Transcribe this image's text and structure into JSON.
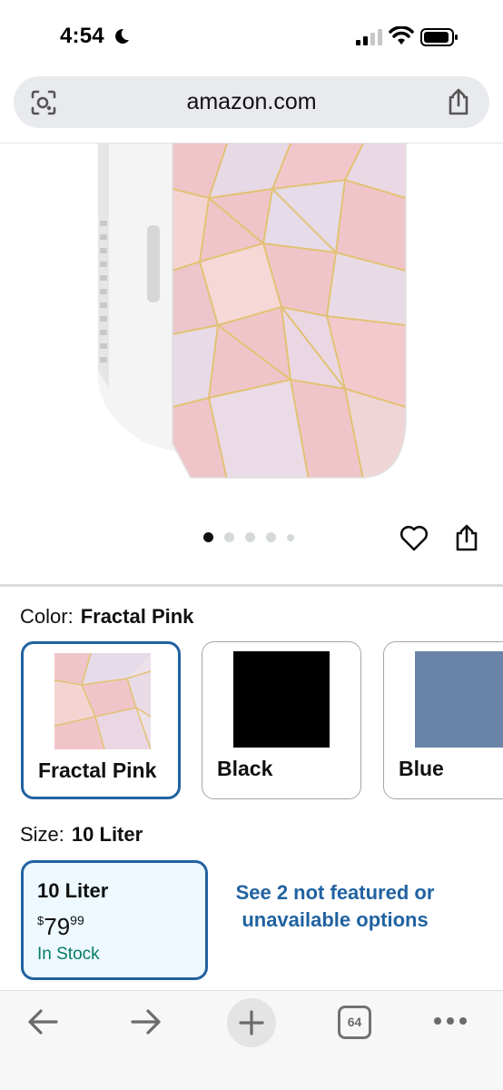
{
  "status_bar": {
    "time": "4:54"
  },
  "browser": {
    "url": "amazon.com"
  },
  "carousel": {
    "total_dots": 5,
    "active_index": 0
  },
  "color": {
    "label": "Color:",
    "selected": "Fractal Pink",
    "options": [
      {
        "name": "Fractal Pink",
        "selected": true
      },
      {
        "name": "Black",
        "selected": false
      },
      {
        "name": "Blue",
        "selected": false
      }
    ]
  },
  "size": {
    "label": "Size:",
    "selected": "10 Liter",
    "card": {
      "name": "10 Liter",
      "price_symbol": "$",
      "price_whole": "79",
      "price_fraction": "99",
      "availability": "In Stock"
    },
    "see_more": "See 2 not featured or unavailable options"
  },
  "toolbar": {
    "tab_count": "64"
  },
  "colors": {
    "accent_blue": "#2162a1",
    "in_stock_green": "#067d62",
    "selected_card_bg": "#edf8ff",
    "swatch_black": "#000000",
    "swatch_blue": "#6a84a8",
    "pink": "#f0c5c9"
  },
  "icons": [
    "lens-icon",
    "share-icon",
    "heart-icon",
    "back-arrow-icon",
    "forward-arrow-icon",
    "plus-icon",
    "tabs-icon",
    "more-icon"
  ]
}
